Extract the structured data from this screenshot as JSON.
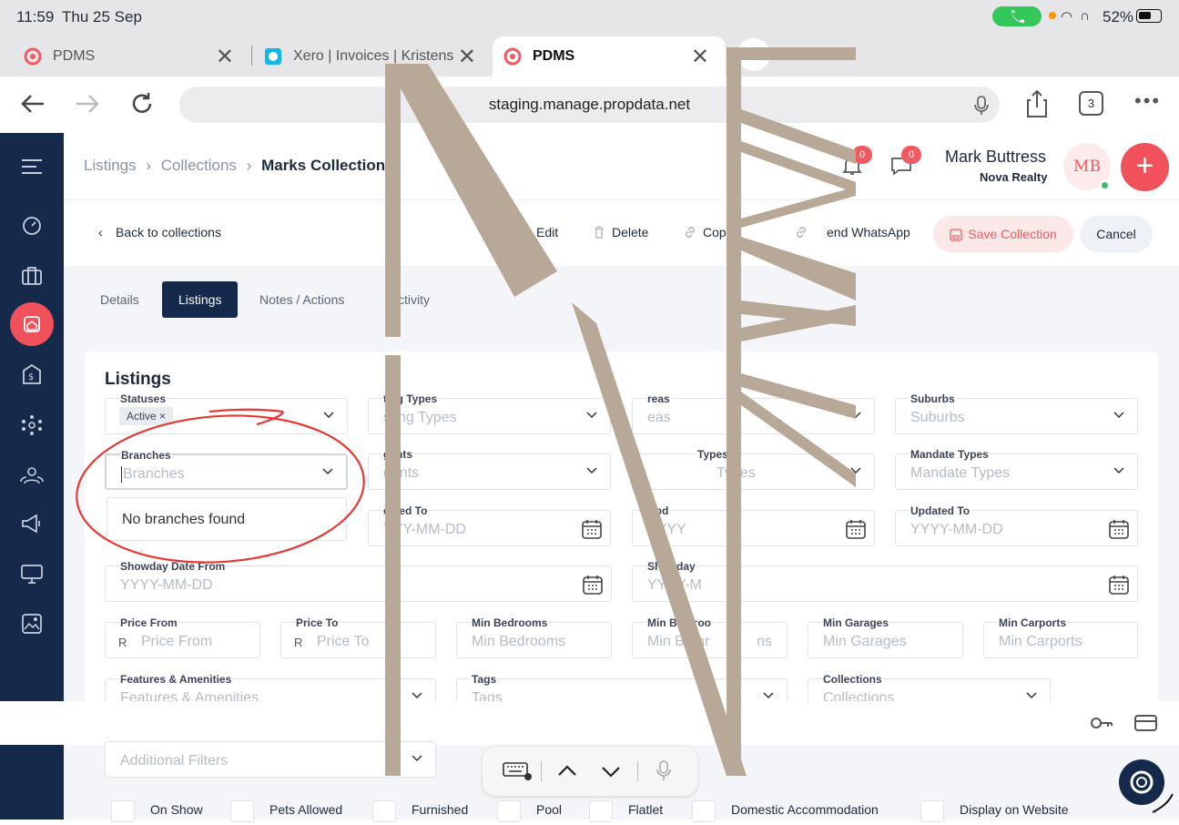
{
  "status": {
    "time": "11:59",
    "date": "Thu 25 Sep",
    "battery": "52%"
  },
  "tabs": [
    {
      "title": "PDMS"
    },
    {
      "title": "Xero | Invoices | Kristens"
    },
    {
      "title": "PDMS"
    }
  ],
  "url": "staging.manage.propdata.net",
  "tab_count": "3",
  "breadcrumb": {
    "a": "Listings",
    "b": "Collections",
    "c": "Marks Collection"
  },
  "user": {
    "name": "Mark Buttress",
    "org": "Nova Realty",
    "initials": "MB",
    "bell_count": "0",
    "msg_count": "0"
  },
  "actions": {
    "back": "Back to collections",
    "edit": "Edit",
    "delete": "Delete",
    "copy": "Cop",
    "whatsapp": "end WhatsApp",
    "save": "Save Collection",
    "cancel": "Cancel"
  },
  "subtabs": [
    "Details",
    "Listings",
    "Notes / Actions",
    "ctivity"
  ],
  "card_title": "Listings",
  "fields": {
    "statuses": {
      "label": "Statuses",
      "tag": "Active ×"
    },
    "listing_types": {
      "label": "ting Types",
      "ph": "sting Types"
    },
    "areas": {
      "label": "reas",
      "ph": "eas"
    },
    "suburbs": {
      "label": "Suburbs",
      "ph": "Suburbs"
    },
    "branches": {
      "label": "Branches",
      "ph": "Branches"
    },
    "agents": {
      "label": "gents",
      "ph": "gents"
    },
    "prop_types": {
      "label": "Types",
      "ph": "Types"
    },
    "mandate": {
      "label": "Mandate Types",
      "ph": "Mandate Types"
    },
    "created_to": {
      "label": "eated To",
      "ph": "YYY-MM-DD"
    },
    "updated_from": {
      "label": "Upd",
      "ph": "YYYY"
    },
    "updated_to": {
      "label": "Updated To",
      "ph": "YYYY-MM-DD"
    },
    "showday_from": {
      "label": "Showday Date From",
      "ph": "YYYY-MM-DD"
    },
    "showday_to": {
      "label": "Showday",
      "label2": "o",
      "ph": "YYYY-M"
    },
    "price_from": {
      "label": "Price From",
      "prefix": "R",
      "ph": "Price From"
    },
    "price_to": {
      "label": "Price To",
      "prefix": "R",
      "ph": "Price To"
    },
    "min_bed": {
      "label": "Min Bedrooms",
      "ph": "Min Bedrooms"
    },
    "min_bath": {
      "label": "Min Bathroo",
      "ph": "Min Bathr",
      "ph2": "ns"
    },
    "min_gar": {
      "label": "Min Garages",
      "ph": "Min Garages"
    },
    "min_carp": {
      "label": "Min Carports",
      "ph": "Min Carports"
    },
    "features": {
      "label": "Features & Amenities",
      "ph": "Features & Amenities"
    },
    "tags": {
      "label": "Tags",
      "ph": "Tags"
    },
    "collections": {
      "label": "Collections",
      "ph": "Collections"
    },
    "additional": {
      "ph": "Additional Filters"
    }
  },
  "dropdown_empty": "No branches found",
  "checkboxes": [
    "On Show",
    "Pets Allowed",
    "Furnished",
    "Pool",
    "Flatlet",
    "Domestic Accommodation",
    "Display on Website"
  ],
  "colors": {
    "navy": "#15294b",
    "accent": "#f05a60",
    "watermark": "#b8a898",
    "annotation": "#e53935"
  }
}
